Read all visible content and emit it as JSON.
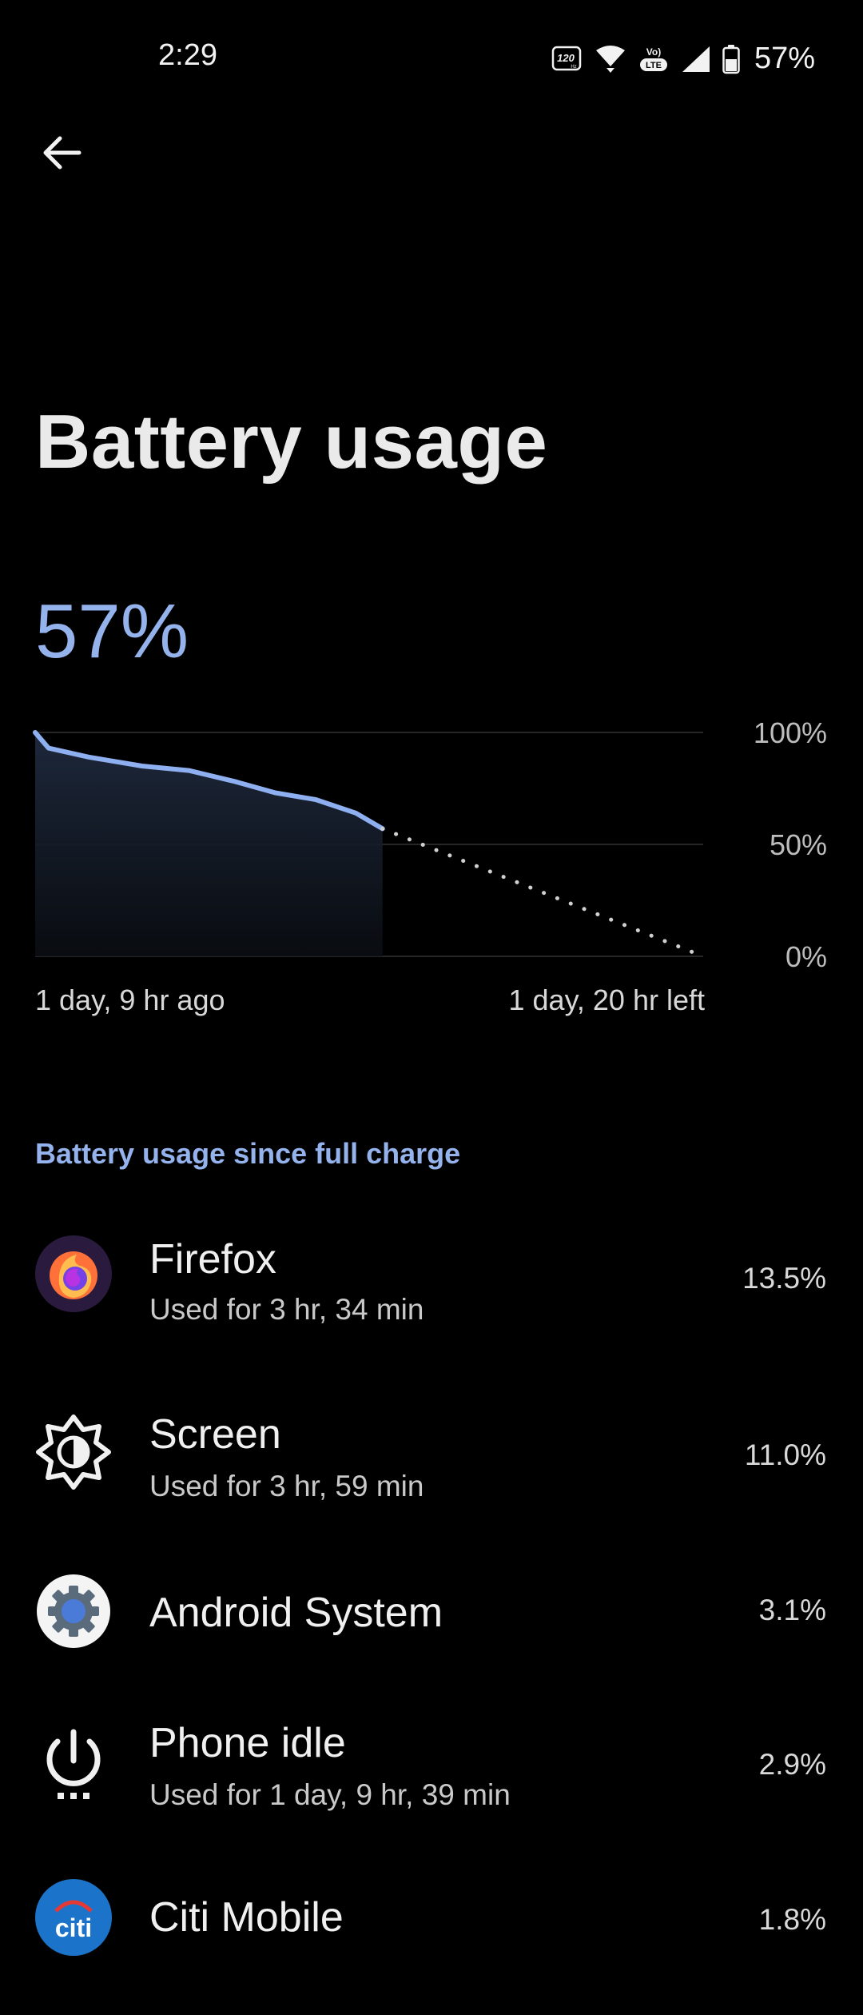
{
  "status_bar": {
    "time": "2:29",
    "refresh_badge": "120",
    "refresh_unit": "Hz",
    "volte_top": "Vo)",
    "volte_bottom": "LTE",
    "battery_percent": "57%"
  },
  "header": {
    "back_icon": "arrow-left-icon",
    "title": "Battery usage"
  },
  "battery_level": "57%",
  "chart_data": {
    "type": "line",
    "y_tick_labels": [
      "100%",
      "50%",
      "0%"
    ],
    "ylim": [
      0,
      100
    ],
    "x_range": [
      0,
      1
    ],
    "series": [
      {
        "values_x": [
          0,
          0.02,
          0.08,
          0.16,
          0.23,
          0.3,
          0.36,
          0.42,
          0.48,
          0.52
        ],
        "values_y": [
          100,
          93,
          89,
          85,
          83,
          78,
          73,
          70,
          64,
          57
        ]
      }
    ],
    "projection": {
      "x": [
        0.52,
        1.0
      ],
      "y": [
        57,
        0
      ]
    },
    "start_label": "1 day, 9 hr ago",
    "end_label": "1 day, 20 hr left",
    "line_color": "#8fb0f0",
    "grid": true
  },
  "section": {
    "title": "Battery usage since full charge"
  },
  "apps": [
    {
      "name": "Firefox",
      "sub": "Used for 3 hr, 34 min",
      "percent": "13.5%",
      "icon": "firefox-icon"
    },
    {
      "name": "Screen",
      "sub": "Used for 3 hr, 59 min",
      "percent": "11.0%",
      "icon": "brightness-icon"
    },
    {
      "name": "Android System",
      "sub": "",
      "percent": "3.1%",
      "icon": "android-settings-gear-icon"
    },
    {
      "name": "Phone idle",
      "sub": "Used for 1 day, 9 hr, 39 min",
      "percent": "2.9%",
      "icon": "power-icon"
    },
    {
      "name": "Citi Mobile",
      "sub": "",
      "percent": "1.8%",
      "icon": "citi-icon"
    }
  ]
}
